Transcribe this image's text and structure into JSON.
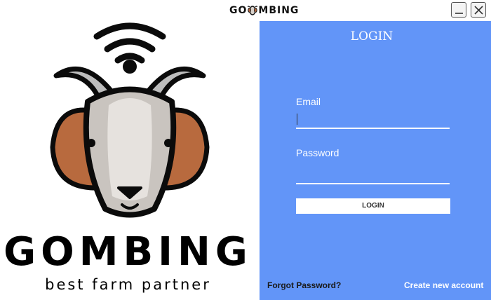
{
  "window": {
    "title_parts": [
      "GO",
      "MBING"
    ],
    "title_icon": "goat-head-icon",
    "minimize_icon": "minimize-icon",
    "close_icon": "close-icon"
  },
  "branding": {
    "logo_icon": "goat-wifi-logo",
    "name": "GOMBING",
    "tagline": "best farm partner"
  },
  "login": {
    "title": "LOGIN",
    "email_label": "Email",
    "email_value": "",
    "password_label": "Password",
    "password_value": "",
    "button_label": "LOGIN",
    "forgot_link": "Forgot Password?",
    "create_link": "Create new account"
  },
  "colors": {
    "panel_bg": "#6295f8",
    "text_white": "#ffffff",
    "goat_ears": "#b86a3e",
    "goat_face": "#cfcac5"
  }
}
